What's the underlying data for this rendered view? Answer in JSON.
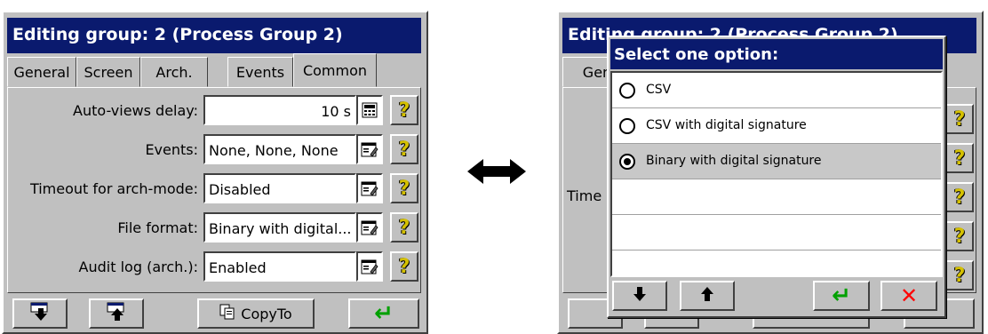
{
  "left": {
    "title": "Editing group: 2 (Process Group 2)",
    "tabs": [
      "General",
      "Screen",
      "Arch.",
      "Events",
      "Common"
    ],
    "rows": [
      {
        "label": "Auto-views delay:",
        "value": "10 s",
        "button_icon": "calculator-icon"
      },
      {
        "label": "Events:",
        "value": "None, None, None",
        "button_icon": "properties-icon"
      },
      {
        "label": "Timeout for arch-mode:",
        "value": "Disabled",
        "button_icon": "properties-icon"
      },
      {
        "label": "File format:",
        "value": "Binary with digital...",
        "button_icon": "properties-icon"
      },
      {
        "label": "Audit log (arch.):",
        "value": "Enabled",
        "button_icon": "properties-icon"
      }
    ],
    "help_glyph": "?",
    "toolbar": {
      "copy_label": "CopyTo",
      "enter_glyph": "↵"
    }
  },
  "right": {
    "bg_title": "Editing group: 2 (Process Group 2)",
    "bg_tab_partial": "Gen",
    "bg_row_partial": "Time",
    "dialog": {
      "title": "Select one option:",
      "options": [
        {
          "label": "CSV",
          "selected": false
        },
        {
          "label": "CSV with digital signature",
          "selected": false
        },
        {
          "label": "Binary with digital signature",
          "selected": true
        }
      ],
      "buttons": {
        "enter_glyph": "↵",
        "cancel_glyph": "✕"
      }
    }
  },
  "colors": {
    "titlebar": "#0a1a6e",
    "panel": "#c0c0c0",
    "enter": "#00a000",
    "cancel": "#ff0000",
    "help": "#d4c000"
  }
}
